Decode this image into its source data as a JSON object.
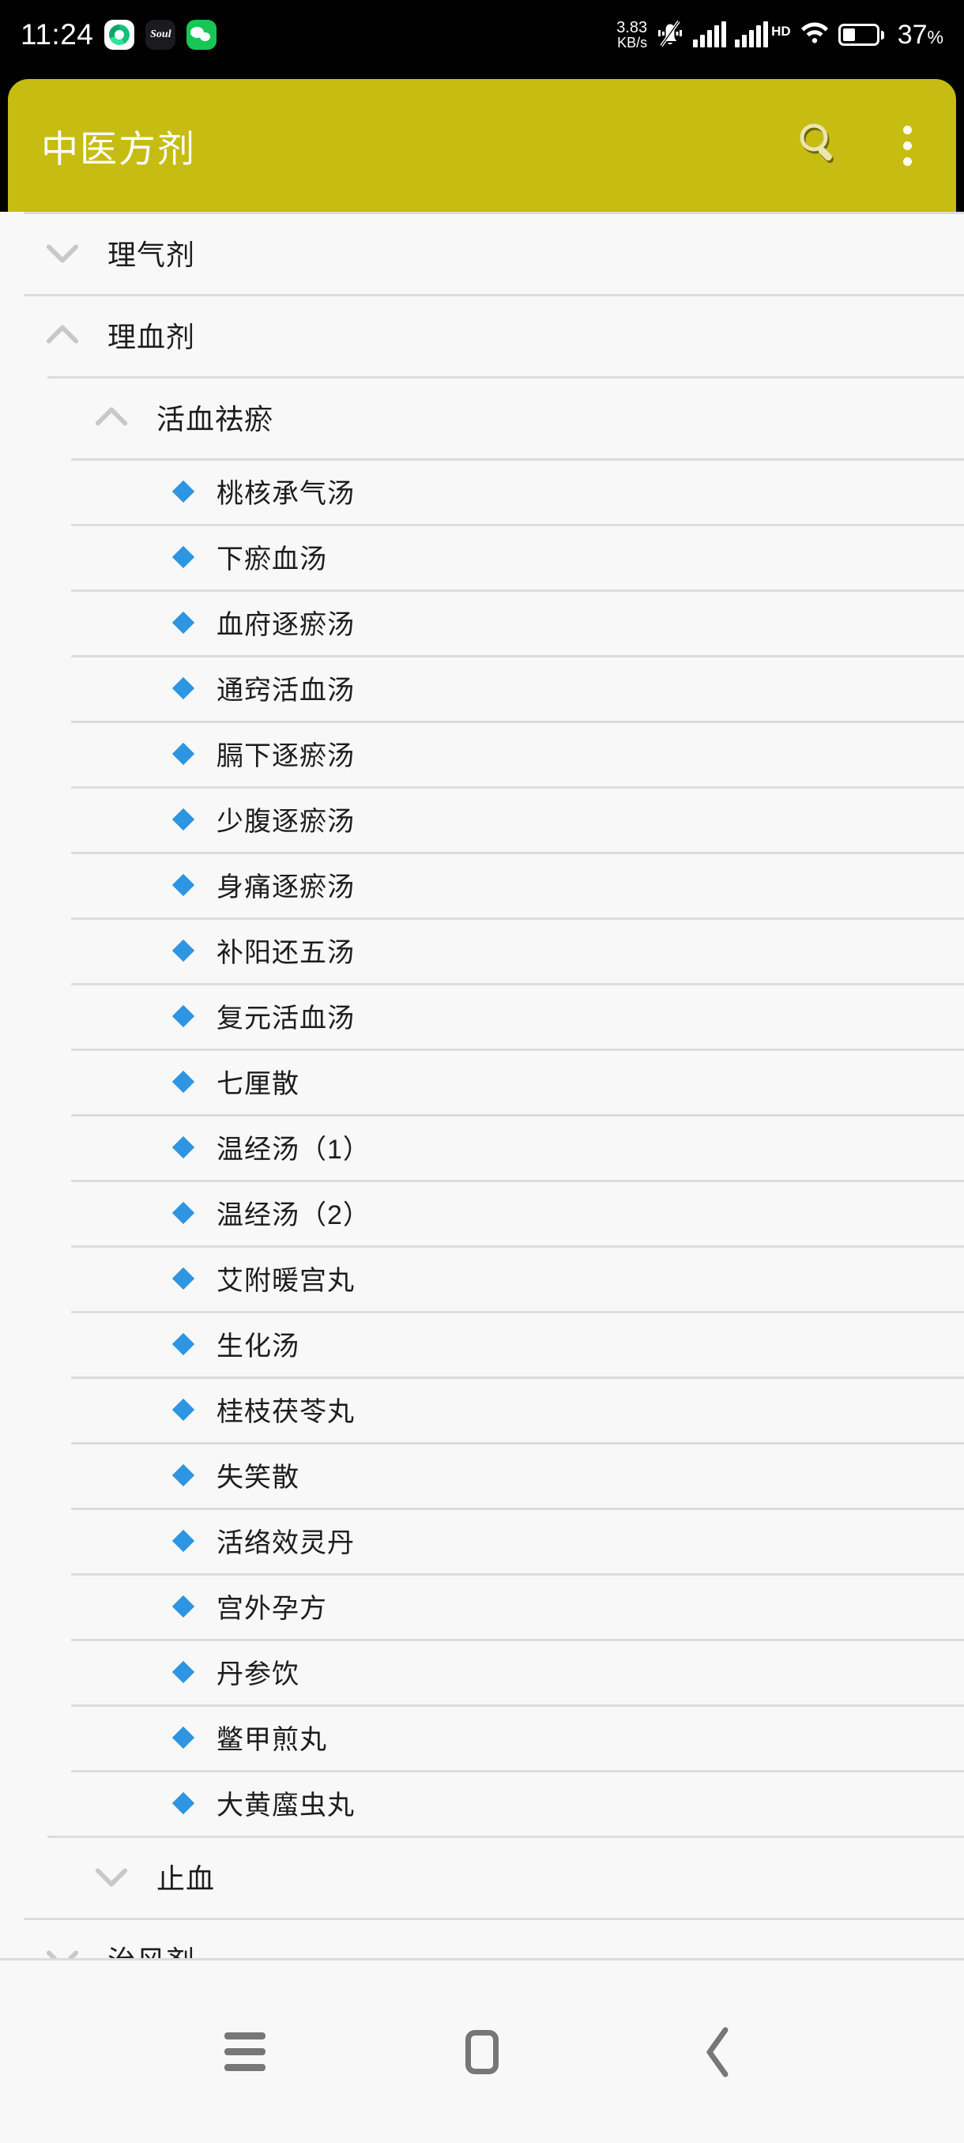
{
  "status_bar": {
    "time": "11:24",
    "app_icons": [
      "green-camera-app-icon",
      "soul-app-icon",
      "wechat-app-icon"
    ],
    "soul_label": "Soul",
    "net_speed_value": "3.83",
    "net_speed_unit": "KB/s",
    "mute_icon": "silent-vibrate-off-icon",
    "signal_icon": "cellular-signal-icon",
    "hd_label": "HD",
    "hd_signal_icon": "cellular-signal-hd-icon",
    "wifi_icon": "wifi-icon",
    "battery_icon": "battery-icon",
    "battery_percent": "37",
    "battery_percent_symbol": "%"
  },
  "app_bar": {
    "title": "中医方剂",
    "background_color": "#c6bc12",
    "title_color": "#ffffff",
    "search_icon": "search-icon",
    "overflow_icon": "more-vertical-icon"
  },
  "colors": {
    "accent": "#c6bc12",
    "bullet": "#2d95e2",
    "divider": "#dcdcdc",
    "page_background": "#f8f8f8",
    "text": "#1d1d1d",
    "chevron": "#c8c8c8"
  },
  "tree": [
    {
      "level": 1,
      "label": "理气剂",
      "state": "collapsed",
      "chevron": "chevron-down-icon"
    },
    {
      "level": 1,
      "label": "理血剂",
      "state": "expanded",
      "chevron": "chevron-up-icon"
    },
    {
      "level": 2,
      "label": "活血祛瘀",
      "state": "expanded",
      "chevron": "chevron-up-icon"
    },
    {
      "level": 3,
      "label": "桃核承气汤",
      "state": "leaf",
      "chevron": ""
    },
    {
      "level": 3,
      "label": "下瘀血汤",
      "state": "leaf",
      "chevron": ""
    },
    {
      "level": 3,
      "label": "血府逐瘀汤",
      "state": "leaf",
      "chevron": ""
    },
    {
      "level": 3,
      "label": "通窍活血汤",
      "state": "leaf",
      "chevron": ""
    },
    {
      "level": 3,
      "label": "膈下逐瘀汤",
      "state": "leaf",
      "chevron": ""
    },
    {
      "level": 3,
      "label": "少腹逐瘀汤",
      "state": "leaf",
      "chevron": ""
    },
    {
      "level": 3,
      "label": "身痛逐瘀汤",
      "state": "leaf",
      "chevron": ""
    },
    {
      "level": 3,
      "label": "补阳还五汤",
      "state": "leaf",
      "chevron": ""
    },
    {
      "level": 3,
      "label": "复元活血汤",
      "state": "leaf",
      "chevron": ""
    },
    {
      "level": 3,
      "label": "七厘散",
      "state": "leaf",
      "chevron": ""
    },
    {
      "level": 3,
      "label": "温经汤（1）",
      "state": "leaf",
      "chevron": ""
    },
    {
      "level": 3,
      "label": "温经汤（2）",
      "state": "leaf",
      "chevron": ""
    },
    {
      "level": 3,
      "label": "艾附暖宫丸",
      "state": "leaf",
      "chevron": ""
    },
    {
      "level": 3,
      "label": "生化汤",
      "state": "leaf",
      "chevron": ""
    },
    {
      "level": 3,
      "label": "桂枝茯苓丸",
      "state": "leaf",
      "chevron": ""
    },
    {
      "level": 3,
      "label": "失笑散",
      "state": "leaf",
      "chevron": ""
    },
    {
      "level": 3,
      "label": "活络效灵丹",
      "state": "leaf",
      "chevron": ""
    },
    {
      "level": 3,
      "label": "宫外孕方",
      "state": "leaf",
      "chevron": ""
    },
    {
      "level": 3,
      "label": "丹参饮",
      "state": "leaf",
      "chevron": ""
    },
    {
      "level": 3,
      "label": "鳖甲煎丸",
      "state": "leaf",
      "chevron": ""
    },
    {
      "level": 3,
      "label": "大黄䗪虫丸",
      "state": "leaf",
      "chevron": ""
    },
    {
      "level": 2,
      "label": "止血",
      "state": "collapsed",
      "chevron": "chevron-down-icon"
    },
    {
      "level": 1,
      "label": "治风剂",
      "state": "collapsed",
      "chevron": "chevron-down-icon"
    }
  ],
  "nav_bar": {
    "recents_icon": "menu-icon",
    "home_icon": "home-square-icon",
    "back_icon": "back-chevron-icon"
  }
}
